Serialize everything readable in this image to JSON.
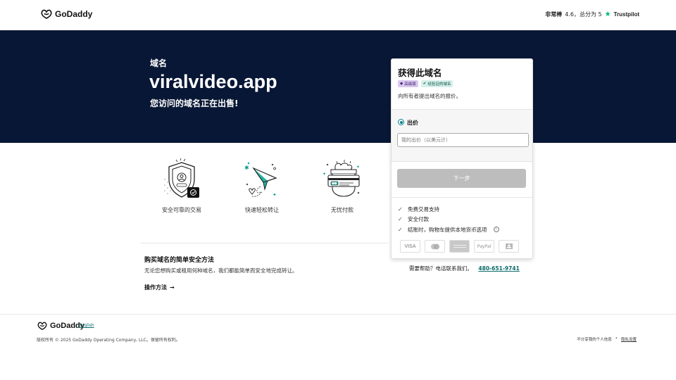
{
  "header": {
    "logo_text": "GoDaddy",
    "rating_label": "非常棒",
    "rating_value": "4.6，总分为 5",
    "trustpilot": "Trustpilot"
  },
  "hero": {
    "label": "域名",
    "domain": "viralvideo.app",
    "subtitle": "您访问的域名正在出售!"
  },
  "features": [
    {
      "icon": "shield-icon",
      "caption": "安全可靠的交易"
    },
    {
      "icon": "paper-plane-icon",
      "caption": "快速轻松转让"
    },
    {
      "icon": "credit-card-icon",
      "caption": "无忧付款"
    }
  ],
  "how": {
    "title": "购买域名的简单安全方法",
    "description": "无论您想购买或租用何种域名，我们都能简单而安全地完成转让。",
    "link": "操作方法",
    "arrow": "→"
  },
  "card": {
    "title": "获得此域名",
    "badge_premium": "高级版",
    "badge_verified": "经验证的域名",
    "description": "向所有者提出域名的报价。",
    "option_label": "出价",
    "input_placeholder": "我的出价（以美元计）",
    "next_button": "下一步",
    "benefits": [
      "免费交易支持",
      "安全付款",
      "结账时，购物车提供本地货币选项"
    ],
    "info": "i",
    "check": "✓",
    "payments": [
      {
        "name": "visa-icon",
        "label": "VISA"
      },
      {
        "name": "mastercard-icon",
        "label": ""
      },
      {
        "name": "amex-icon",
        "label": ""
      },
      {
        "name": "paypal-icon",
        "label": "PayPal"
      },
      {
        "name": "bank-icon",
        "label": ""
      }
    ]
  },
  "help": {
    "text": "需要帮助？电话联系我们。",
    "phone": "480-651-9741"
  },
  "footer": {
    "logo_text": "GoDaddy",
    "language": "English",
    "copyright": "版权所有 © 2025 GoDaddy Operating Company, LLC。保留所有权利。",
    "no_sell": "不分享我的个人信息",
    "bullet": "•",
    "privacy": "隐私设置"
  },
  "colors": {
    "hero_bg": "#081735",
    "accent": "#00838c",
    "star": "#00b67a",
    "button_disabled": "#bdbdbd"
  }
}
